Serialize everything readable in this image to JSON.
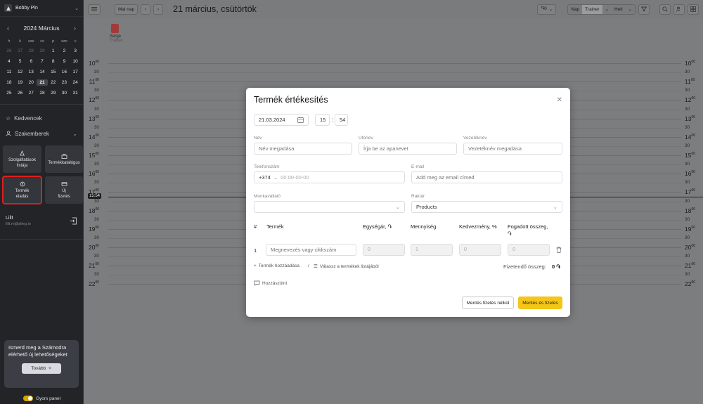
{
  "sidebar": {
    "org_name": "Bobby Pin",
    "calendar": {
      "month_label": "2024 Március",
      "weekdays": [
        "h",
        "k",
        "sze",
        "cs",
        "p",
        "szo",
        "v"
      ],
      "weeks": [
        [
          "26",
          "27",
          "28",
          "29",
          "1",
          "2",
          "3"
        ],
        [
          "4",
          "5",
          "6",
          "7",
          "8",
          "9",
          "10"
        ],
        [
          "11",
          "12",
          "13",
          "14",
          "15",
          "16",
          "17"
        ],
        [
          "18",
          "19",
          "20",
          "21",
          "22",
          "23",
          "24"
        ],
        [
          "25",
          "26",
          "27",
          "28",
          "29",
          "30",
          "31"
        ]
      ],
      "selected_day": "21"
    },
    "nav": [
      {
        "label": "Kedvencek",
        "icon": "star-icon"
      },
      {
        "label": "Szakemberek",
        "icon": "person-icon"
      }
    ],
    "tiles": [
      {
        "label": "Szolgáltatások listája",
        "icon": "services-icon"
      },
      {
        "label": "Termékkatalógus",
        "icon": "catalog-icon"
      },
      {
        "label": "Termék eladás",
        "icon": "product-sale-icon",
        "highlighted": true
      },
      {
        "label": "Új fizetés",
        "icon": "new-payment-icon"
      }
    ],
    "user": {
      "name": "Lilit",
      "email": "lilit.m@alteg.io"
    },
    "promo": {
      "text": "Ismerd meg a Számodra elérhető új lehetőségeket",
      "button": "Tovább"
    },
    "quick_panel": "Gyors panel"
  },
  "topbar": {
    "today": "Mai nap",
    "date": "21 március, csütörtök",
    "currency_btn": "֏0",
    "view_day": "Nap",
    "view_staff": "Trainer",
    "view_week": "Heti"
  },
  "calendar": {
    "staff": {
      "name": "Serge",
      "role": "Trainer"
    },
    "hours": [
      "10",
      "11",
      "12",
      "13",
      "14",
      "15",
      "16",
      "17",
      "18",
      "19",
      "20",
      "21",
      "22"
    ],
    "minutes_label": "00",
    "half_label": "30",
    "now": "15:54"
  },
  "modal": {
    "title": "Termék értékesítés",
    "date": "21.03.2024",
    "hour": "15",
    "minute": "54",
    "labels": {
      "first_name": "Név",
      "middle_name": "Utónév",
      "last_name": "Vezetéknév",
      "phone": "Telefonszám",
      "email": "E-mail",
      "employee": "Munkavállaló",
      "warehouse": "Raktár"
    },
    "placeholders": {
      "first_name": "Név megadása",
      "middle_name": "Írja be az apanevet",
      "last_name": "Vezetéknév megadása",
      "phone": "00 00-00-00",
      "email": "Add meg az email címed",
      "product": "Megnevezés vagy cikkszám"
    },
    "phone_code": "+374",
    "warehouse_value": "Products",
    "table": {
      "headers": [
        "#",
        "Termék",
        "Egységár, ֏",
        "Mennyiség",
        "Kedvezmény, %",
        "Fogadott összeg, ֏"
      ],
      "row": {
        "num": "1",
        "price": "0",
        "qty": "1",
        "discount": "0",
        "received": "0"
      }
    },
    "add_product": "Termék hozzáadása",
    "separator": "/",
    "choose_list": "Válassz a termékek listájából",
    "total_label": "Fizetendő összeg:",
    "total_value": "0 ֏",
    "comment": "Hozzászólni",
    "btn_save": "Mentés fizetés nélkül",
    "btn_save_pay": "Mentés és fizetés",
    "accent": "#f5c518"
  }
}
